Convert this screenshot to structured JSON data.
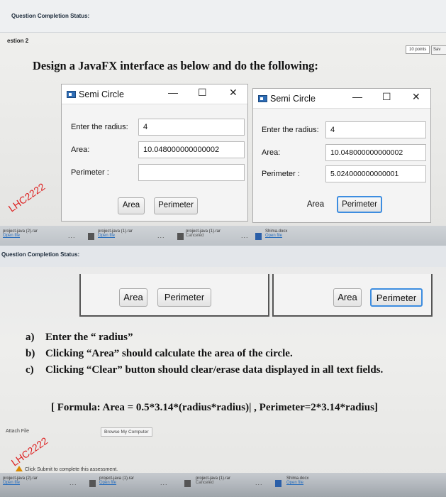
{
  "top": {
    "status_title": "Question Completion Status:",
    "question": "estion 2",
    "points": "10 points",
    "save": "Sav",
    "heading": "Design a JavaFX interface as below and do the following:",
    "window_left": {
      "title": "Semi Circle",
      "radius_label": "Enter the radius:",
      "radius_value": "4",
      "area_label": "Area:",
      "area_value": "10.048000000000002",
      "perimeter_label": "Perimeter :",
      "perimeter_value": "",
      "btn_area": "Area",
      "btn_perimeter": "Perimeter"
    },
    "window_right": {
      "title": "Semi Circle",
      "radius_label": "Enter the radius:",
      "radius_value": "4",
      "area_label": "Area:",
      "area_value": "10.048000000000002",
      "perimeter_label": "Perimeter :",
      "perimeter_value": "5.024000000000001",
      "btn_area": "Area",
      "btn_perimeter": "Perimeter"
    },
    "taskbar": [
      {
        "name": "project-java (2).rar",
        "sub": "Open file"
      },
      {
        "name": "project-java (1).rar",
        "sub": "Open file"
      },
      {
        "name": "project-java (1).rar",
        "sub": "Canceled"
      },
      {
        "name": "Shima.docx",
        "sub": "Open file"
      }
    ]
  },
  "bottom": {
    "status_title": "Question Completion Status:",
    "btn_area_left": "Area",
    "btn_perimeter_left": "Perimeter",
    "btn_area_right": "Area",
    "btn_perimeter_right": "Perimeter",
    "tasks": [
      {
        "letter": "a)",
        "text": "Enter the “ radius”"
      },
      {
        "letter": "b)",
        "text": "Clicking “Area” should calculate the area of the circle."
      },
      {
        "letter": "c)",
        "text": "Clicking “Clear” button should clear/erase data displayed in all text fields."
      }
    ],
    "formula": "[ Formula: Area = 0.5*3.14*(radius*radius)| ,  Perimeter=2*3.14*radius]",
    "attach_label": "Attach File",
    "browse_label": "Browse My Computer",
    "click_submit": "Click Submit to complete this assessment.",
    "taskbar": [
      {
        "name": "project-java (2).rar",
        "sub": "Open file"
      },
      {
        "name": "project-java (1).rar",
        "sub": "Open file"
      },
      {
        "name": "project-java (1).rar",
        "sub": "Canceled"
      },
      {
        "name": "Shima.docx",
        "sub": "Open file"
      }
    ]
  }
}
